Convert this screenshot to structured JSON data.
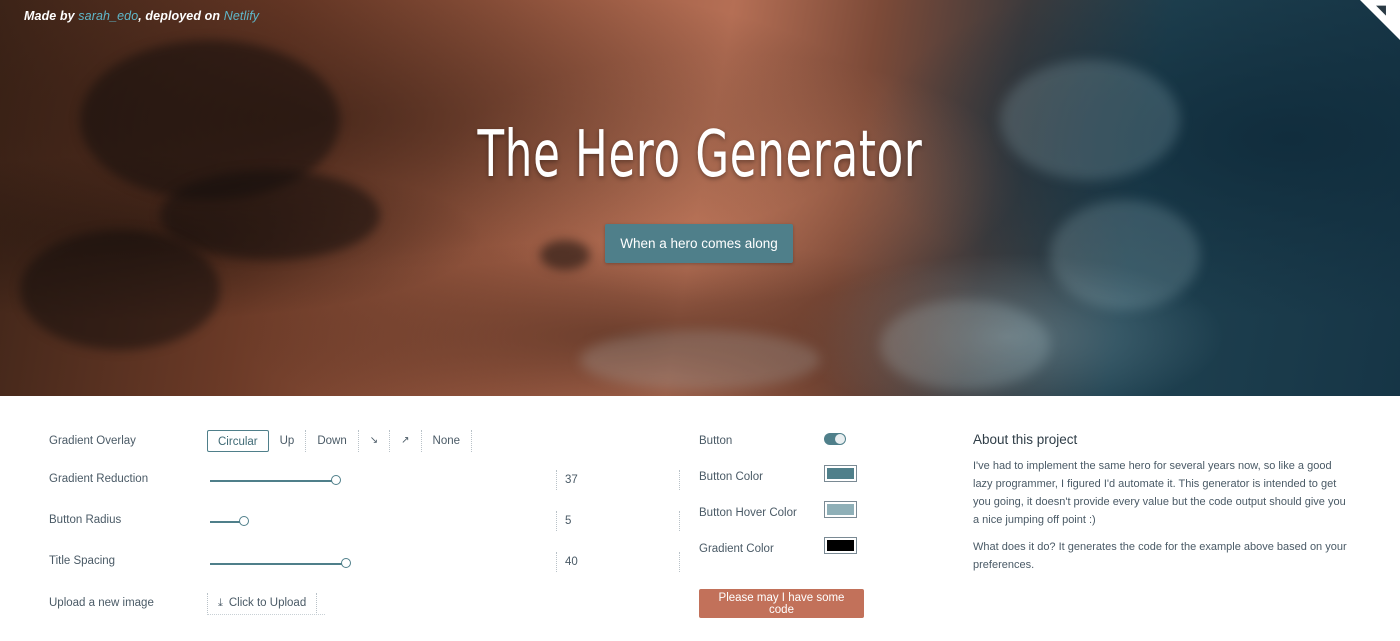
{
  "hero": {
    "credit_made_by": "Made by ",
    "credit_author": "sarah_edo",
    "credit_deployed": ", deployed on ",
    "credit_host": "Netlify",
    "title": "The Hero Generator",
    "button_label": "When a hero comes along",
    "corner_icon": "github-corner-icon"
  },
  "controls": {
    "gradient_overlay": {
      "label": "Gradient Overlay",
      "options": [
        "Circular",
        "Up",
        "Down",
        "↘",
        "↗",
        "None"
      ],
      "selected": "Circular"
    },
    "gradient_reduction": {
      "label": "Gradient Reduction",
      "value": "37",
      "level": 37,
      "max": 100
    },
    "button_radius": {
      "label": "Button Radius",
      "value": "5",
      "level": 5,
      "max": 50
    },
    "title_spacing": {
      "label": "Title Spacing",
      "value": "40",
      "level": 40,
      "max": 100
    },
    "upload": {
      "label": "Upload a new image",
      "button_label": "Click to Upload",
      "icon": "upload-icon"
    }
  },
  "button_settings": {
    "button_toggle": {
      "label": "Button",
      "on": true
    },
    "button_color": {
      "label": "Button Color",
      "color": "#4f7f8a"
    },
    "button_hover_color": {
      "label": "Button Hover Color",
      "color": "#8fb0b8"
    },
    "gradient_color": {
      "label": "Gradient Color",
      "color": "#000000"
    },
    "code_button_label": "Please may I have some code"
  },
  "about": {
    "title": "About this project",
    "paragraph1": "I've had to implement the same hero for several years now, so like a good lazy programmer, I figured I'd automate it. This generator is intended to get you going, it doesn't provide every value but the code output should give you a nice jumping off point :)",
    "paragraph2": "What does it do? It generates the code for the example above based on your preferences."
  },
  "colors": {
    "accent": "#4f7f8a",
    "code_button": "#c2715a"
  }
}
